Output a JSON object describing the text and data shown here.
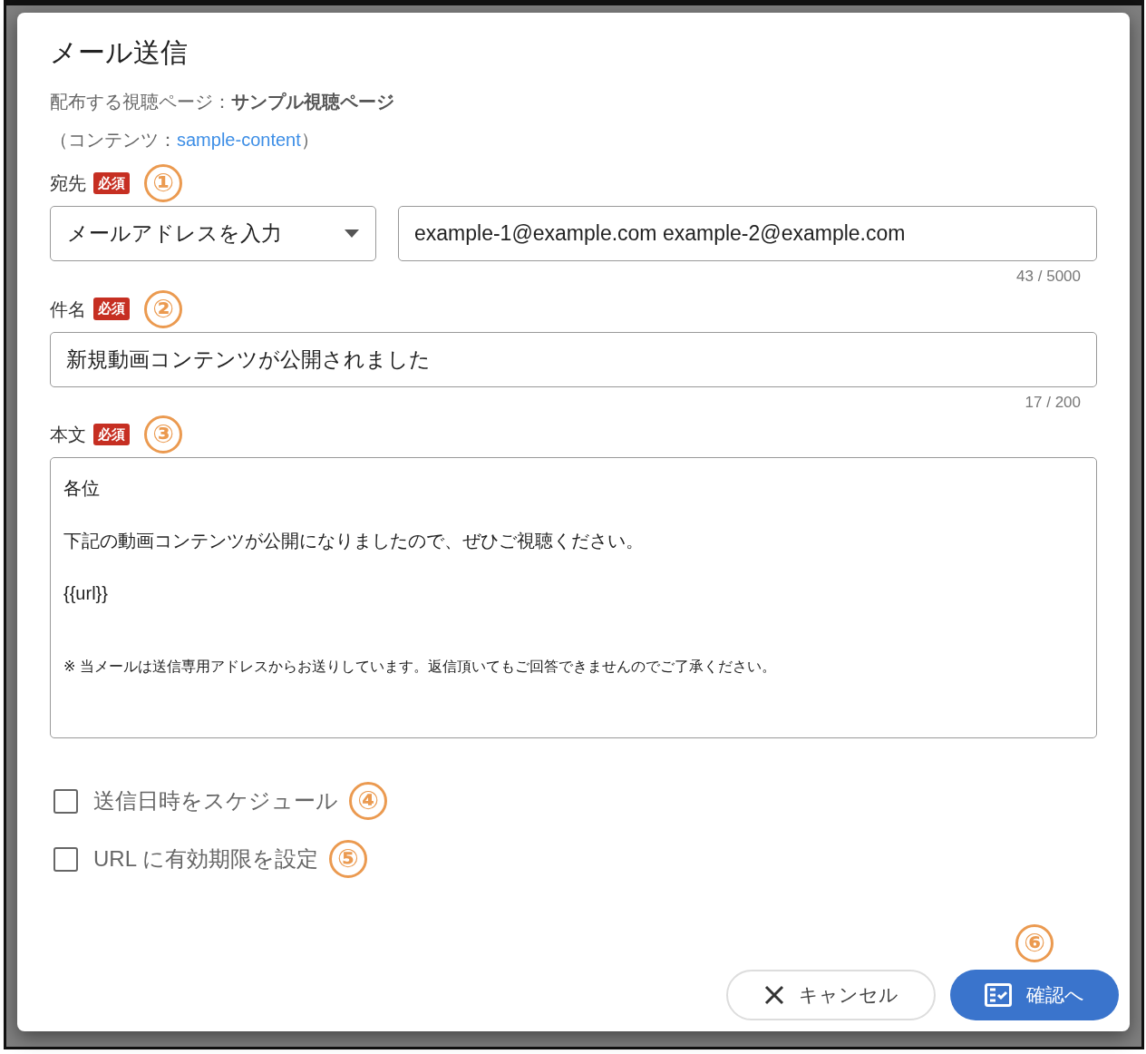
{
  "dialog": {
    "title": "メール送信",
    "page_info": {
      "label": "配布する視聴ページ：",
      "value": "サンプル視聴ページ"
    },
    "content_info": {
      "open": "（コンテンツ：",
      "link": "sample-content",
      "close": "）"
    },
    "fields": [
      {
        "kind": "recipient",
        "label": "宛先",
        "required_badge": "必須",
        "callout": "①",
        "select_value": "メールアドレスを入力",
        "value": "example-1@example.com example-2@example.com",
        "counter": "43 / 5000"
      },
      {
        "kind": "text",
        "label": "件名",
        "required_badge": "必須",
        "callout": "②",
        "value": "新規動画コンテンツが公開されました",
        "counter": "17 / 200"
      },
      {
        "kind": "body",
        "label": "本文",
        "required_badge": "必須",
        "callout": "③",
        "lines": [
          {
            "kind": "normal",
            "text": "各位"
          },
          {
            "kind": "normal",
            "text": "下記の動画コンテンツが公開になりましたので、ぜひご視聴ください。"
          },
          {
            "kind": "normal",
            "text": "{{url}}"
          },
          {
            "kind": "note",
            "text": "※ 当メールは送信専用アドレスからお送りしています。返信頂いてもご回答できませんのでご了承ください。"
          }
        ]
      }
    ],
    "options": [
      {
        "label": "送信日時をスケジュール",
        "checked": false,
        "callout": "④"
      },
      {
        "label": "URL に有効期限を設定",
        "checked": false,
        "callout": "⑤"
      }
    ],
    "buttons": [
      {
        "kind": "cancel",
        "label": "キャンセル"
      },
      {
        "kind": "confirm",
        "label": "確認へ",
        "callout": "⑥"
      }
    ]
  }
}
